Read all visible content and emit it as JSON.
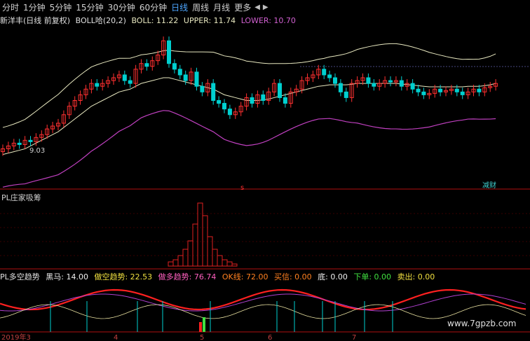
{
  "toolbar": {
    "tabs": [
      "分时",
      "1分钟",
      "5分钟",
      "15分钟",
      "30分钟",
      "60分钟",
      "日线",
      "周线",
      "月线",
      "更多"
    ],
    "active_tab": "日线",
    "nav_prev": "◀",
    "nav_next": "▶"
  },
  "panel_main": {
    "stock": "新洋丰(日线 前复权)",
    "indicator": "BOLL哈(20,2)",
    "boll_label": "BOLL: 11.22",
    "upper_label": "UPPER: 11.74",
    "lower_label": "LOWER: 10.70",
    "low_marker": "9.03",
    "signal_s": "s",
    "corner_tag": "减财"
  },
  "panel_chip": {
    "title": "PL庄家吸筹"
  },
  "panel_trend": {
    "title": "PL多空趋势",
    "black_horse": "黑马: 14.00",
    "short_trend": "做空趋势: 22.53",
    "long_trend": "做多趋势: 76.74",
    "ok_line": "OK线: 72.00",
    "buy_signal": "买信: 0.00",
    "bottom": "底: 0.00",
    "next_order": "下单: 0.00",
    "sell_out": "卖出: 0.00"
  },
  "x_axis": {
    "labels": [
      "2019年3",
      "4",
      "5",
      "6",
      "7"
    ]
  },
  "watermark": "www.7gpzb.com",
  "colors": {
    "up": "#ff3030",
    "down": "#00d0d0",
    "boll_mid": "#e8e8c0",
    "boll_lower": "#c040c0",
    "trend_red": "#ff2020",
    "trend_purple": "#b040d0",
    "trend_yellow": "#e8e0a0",
    "label_yellow": "#f0e040",
    "label_pink": "#ff60c0",
    "label_orange": "#ff8020",
    "label_green": "#40e040"
  },
  "chart_data": {
    "type": "candlestick",
    "x": [
      0,
      1,
      2,
      3,
      4,
      5,
      6,
      7,
      8,
      9,
      10,
      11,
      12,
      13,
      14,
      15,
      16,
      17,
      18,
      19,
      20,
      21,
      22,
      23,
      24,
      25,
      26,
      27,
      28,
      29,
      30,
      31,
      32,
      33,
      34,
      35,
      36,
      37,
      38,
      39,
      40,
      41,
      42,
      43,
      44,
      45,
      46,
      47,
      48,
      49,
      50,
      51,
      52,
      53,
      54,
      55,
      56,
      57,
      58,
      59,
      60,
      61,
      62,
      63,
      64,
      65,
      66,
      67,
      68,
      69,
      70,
      71,
      72,
      73,
      74,
      75,
      76,
      77,
      78,
      79,
      80,
      81,
      82,
      83,
      84,
      85,
      86,
      87,
      88,
      89
    ],
    "close": [
      9.6,
      9.7,
      9.8,
      9.75,
      9.9,
      9.85,
      10.0,
      10.1,
      10.3,
      10.4,
      10.5,
      10.8,
      11.1,
      11.3,
      11.5,
      11.7,
      11.9,
      11.8,
      11.9,
      12.0,
      12.1,
      12.2,
      12.0,
      11.9,
      12.4,
      12.6,
      12.5,
      12.7,
      12.9,
      13.4,
      12.6,
      12.4,
      12.2,
      12.0,
      12.3,
      11.8,
      11.6,
      11.9,
      11.3,
      11.2,
      11.0,
      10.8,
      10.9,
      11.1,
      11.4,
      11.2,
      11.5,
      11.3,
      11.6,
      11.9,
      11.4,
      11.2,
      11.6,
      11.7,
      12.0,
      12.1,
      12.2,
      12.4,
      12.2,
      12.1,
      11.9,
      11.6,
      11.4,
      11.9,
      12.0,
      12.1,
      11.9,
      11.8,
      11.9,
      12.0,
      11.95,
      12.0,
      11.8,
      11.9,
      11.7,
      11.6,
      11.5,
      11.55,
      11.7,
      11.6,
      11.65,
      11.7,
      11.6,
      11.5,
      11.6,
      11.7,
      11.6,
      11.75,
      11.8,
      11.9
    ],
    "boll_mid": [
      9.4,
      9.45,
      9.5,
      9.55,
      9.6,
      9.7,
      9.8,
      9.9,
      10.0,
      10.1,
      10.2,
      10.35,
      10.5,
      10.65,
      10.8,
      10.95,
      11.1,
      11.2,
      11.3,
      11.4,
      11.5,
      11.6,
      11.65,
      11.7,
      11.8,
      11.9,
      11.95,
      12.0,
      12.05,
      12.1,
      12.1,
      12.05,
      12.0,
      11.95,
      11.9,
      11.85,
      11.8,
      11.75,
      11.7,
      11.6,
      11.5,
      11.45,
      11.4,
      11.35,
      11.3,
      11.3,
      11.3,
      11.32,
      11.35,
      11.4,
      11.45,
      11.5,
      11.55,
      11.6,
      11.65,
      11.7,
      11.75,
      11.8,
      11.82,
      11.85,
      11.85,
      11.85,
      11.85,
      11.87,
      11.9,
      11.9,
      11.9,
      11.9,
      11.9,
      11.9,
      11.9,
      11.9,
      11.88,
      11.86,
      11.84,
      11.82,
      11.8,
      11.78,
      11.78,
      11.78,
      11.78,
      11.78,
      11.78,
      11.78,
      11.8,
      11.8,
      11.8,
      11.82,
      11.85,
      11.9
    ],
    "ylim": [
      8.8,
      13.8
    ],
    "volume_chip_bins": [
      2,
      3,
      5,
      8,
      12,
      20,
      30,
      24,
      14,
      8,
      5,
      3,
      2,
      1
    ],
    "x_axis_labels": [
      "2019年3",
      "4",
      "5",
      "6",
      "7"
    ]
  }
}
